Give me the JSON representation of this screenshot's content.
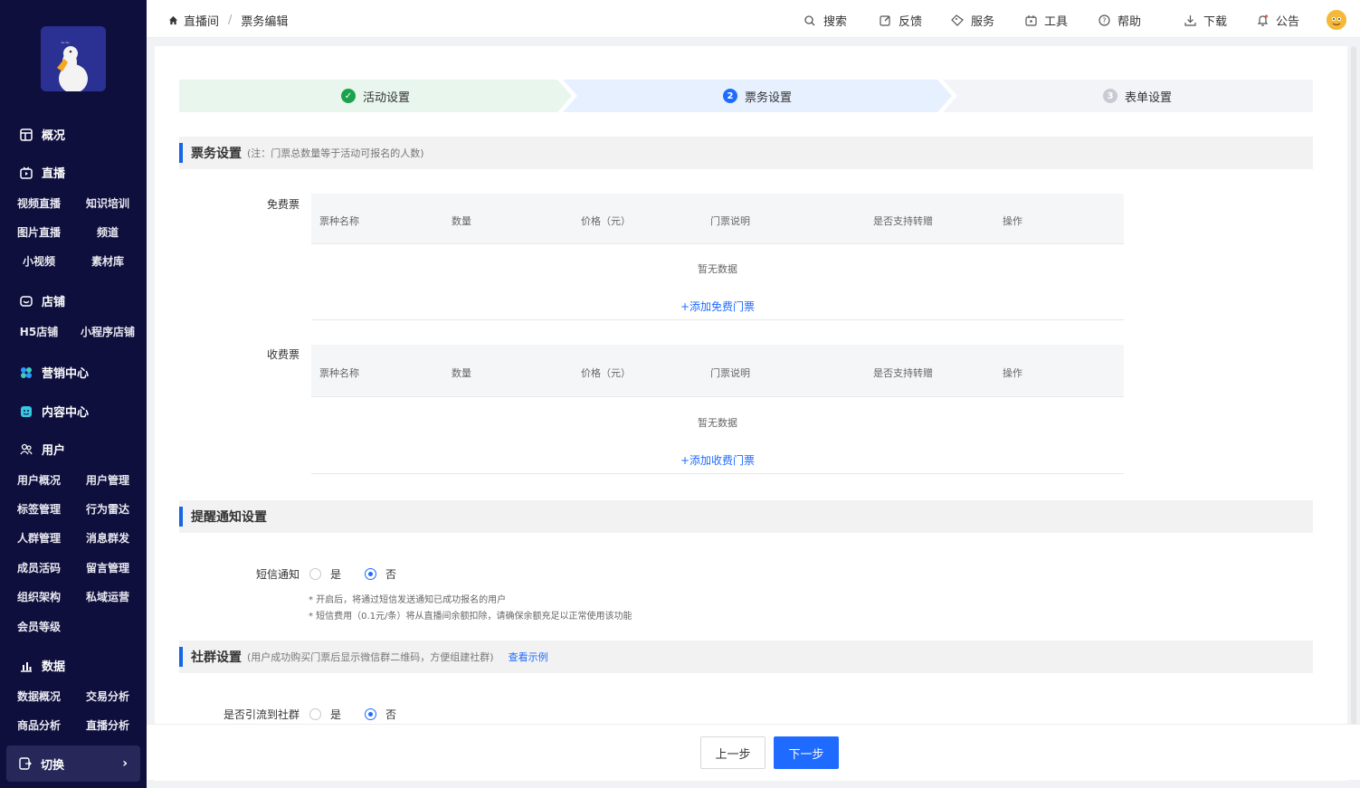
{
  "sidebar": {
    "sections": [
      {
        "label": "概况",
        "icon": "dashboard-icon"
      },
      {
        "label": "直播",
        "icon": "live-icon"
      },
      {
        "label": "店铺",
        "icon": "store-icon"
      },
      {
        "label": "营销中心",
        "icon": "marketing-icon"
      },
      {
        "label": "内容中心",
        "icon": "content-icon"
      },
      {
        "label": "用户",
        "icon": "users-icon"
      },
      {
        "label": "数据",
        "icon": "chart-icon"
      }
    ],
    "live_items": [
      "视频直播",
      "知识培训",
      "图片直播",
      "频道",
      "小视频",
      "素材库"
    ],
    "store_items": [
      "H5店铺",
      "小程序店铺"
    ],
    "user_items": [
      "用户概况",
      "用户管理",
      "标签管理",
      "行为雷达",
      "人群管理",
      "消息群发",
      "成员活码",
      "留言管理",
      "组织架构",
      "私域运营",
      "会员等级"
    ],
    "data_items": [
      "数据概况",
      "交易分析",
      "商品分析",
      "直播分析"
    ],
    "switch_label": "切换"
  },
  "header": {
    "breadcrumb": [
      "直播间",
      "票务编辑"
    ],
    "nav": [
      {
        "label": "搜索",
        "icon": "search-icon"
      },
      {
        "label": "反馈",
        "icon": "edit-icon"
      },
      {
        "label": "服务",
        "icon": "tag-icon"
      },
      {
        "label": "工具",
        "icon": "tool-icon"
      },
      {
        "label": "帮助",
        "icon": "help-icon"
      },
      {
        "label": "下载",
        "icon": "download-icon"
      },
      {
        "label": "公告",
        "icon": "bell-icon"
      }
    ]
  },
  "steps": [
    {
      "num": "✓",
      "label": "活动设置",
      "state": "done"
    },
    {
      "num": "2",
      "label": "票务设置",
      "state": "active"
    },
    {
      "num": "3",
      "label": "表单设置",
      "state": "pending"
    }
  ],
  "ticket_section": {
    "title": "票务设置",
    "note": "(注：门票总数量等于活动可报名的人数)",
    "columns": [
      "票种名称",
      "数量",
      "价格（元）",
      "门票说明",
      "是否支持转赠",
      "操作"
    ],
    "free": {
      "label": "免费票",
      "empty": "暂无数据",
      "add": "+添加免费门票"
    },
    "paid": {
      "label": "收费票",
      "empty": "暂无数据",
      "add": "+添加收费门票"
    }
  },
  "notify_section": {
    "title": "提醒通知设置",
    "sms_label": "短信通知",
    "yes": "是",
    "no": "否",
    "selected": "否",
    "hints": [
      "* 开启后，将通过短信发送通知已成功报名的用户",
      "* 短信费用（0.1元/条）将从直播间余额扣除，请确保余额充足以正常使用该功能"
    ]
  },
  "group_section": {
    "title": "社群设置",
    "note": "(用户成功购买门票后显示微信群二维码，方便组建社群)",
    "link": "查看示例",
    "label": "是否引流到社群",
    "yes": "是",
    "no": "否",
    "selected": "否"
  },
  "footer": {
    "prev": "上一步",
    "next": "下一步"
  },
  "colors": {
    "primary": "#1f6bff",
    "sidebar": "#0f0f3d",
    "step_done": "#e8f6ee",
    "step_active": "#e6f0ff",
    "step_pending": "#f2f4f8"
  }
}
